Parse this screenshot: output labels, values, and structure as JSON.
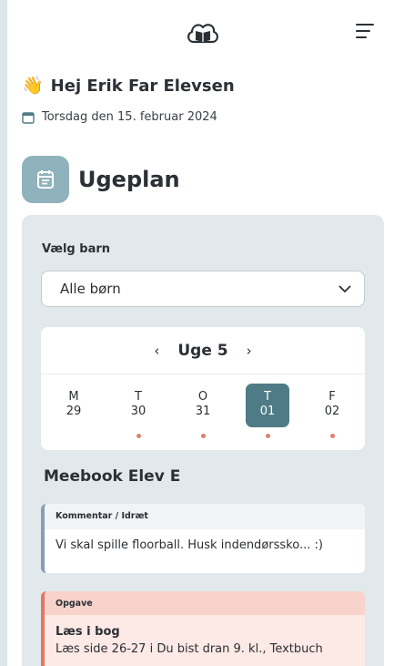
{
  "header": {
    "logo_icon": "cloud-book-icon",
    "menu_icon": "hamburger-menu-icon"
  },
  "greeting": {
    "emoji": "👋",
    "text": "Hej Erik Far Elevsen"
  },
  "date": {
    "icon": "calendar-icon",
    "text": "Torsdag den 15. februar 2024"
  },
  "section": {
    "icon": "calendar-list-icon",
    "title": "Ugeplan"
  },
  "child_select": {
    "label": "Vælg barn",
    "value": "Alle børn"
  },
  "week": {
    "label": "Uge 5",
    "prev": "‹",
    "next": "›",
    "days": [
      {
        "letter": "M",
        "date": "29",
        "active": false,
        "has_event": false
      },
      {
        "letter": "T",
        "date": "30",
        "active": false,
        "has_event": true
      },
      {
        "letter": "O",
        "date": "31",
        "active": false,
        "has_event": true
      },
      {
        "letter": "T",
        "date": "01",
        "active": true,
        "has_event": true
      },
      {
        "letter": "F",
        "date": "02",
        "active": false,
        "has_event": true
      }
    ],
    "event_dot_color": "#e0806c",
    "active_color": "#4e7b85"
  },
  "student_name": "Meebook Elev E",
  "cards": [
    {
      "type": "Kommentar / Idræt",
      "body": "Vi skal spille floorball. Husk indendørssko... :)",
      "accent": "#8a9cb5"
    },
    {
      "type": "Opgave",
      "title": "Læs i bog",
      "body": "Læs side 26-27 i Du bist dran 9. kl., Textbuch",
      "accent": "#e57563"
    }
  ]
}
